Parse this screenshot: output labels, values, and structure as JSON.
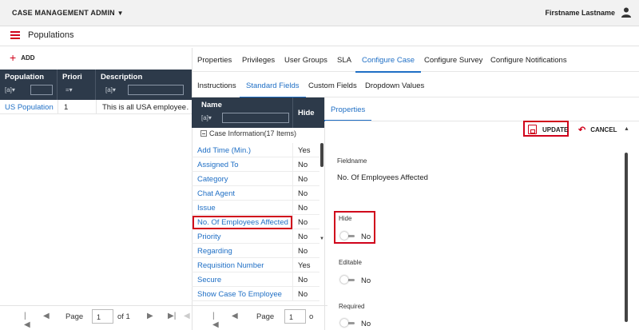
{
  "topbar": {
    "app_name": "CASE MANAGEMENT ADMIN",
    "dropdown_icon": "caret-down-icon",
    "user_name": "Firstname Lastname",
    "user_icon": "person-icon"
  },
  "page": {
    "title": "Populations",
    "add_label": "ADD"
  },
  "populations_grid": {
    "columns": [
      "Population",
      "Priori",
      "Description"
    ],
    "filter_symbols": {
      "text": "[a]▾",
      "equals": "=▾"
    },
    "rows": [
      {
        "population": "US Population",
        "priority": "1",
        "description": "This is all USA employee…"
      }
    ]
  },
  "main_tabs": [
    "Properties",
    "Privileges",
    "User Groups",
    "SLA",
    "Configure Case",
    "Configure Survey",
    "Configure Notifications"
  ],
  "active_main_tab": "Configure Case",
  "sub_tabs": [
    "Instructions",
    "Standard Fields",
    "Custom Fields",
    "Dropdown Values"
  ],
  "active_sub_tab": "Standard Fields",
  "fields_grid": {
    "columns": {
      "name": "Name",
      "hide": "Hide"
    },
    "group_label": "Case Information(17 Items)",
    "rows": [
      {
        "name": "Add Time (Min.)",
        "hide": "Yes"
      },
      {
        "name": "Assigned To",
        "hide": "No"
      },
      {
        "name": "Category",
        "hide": "No"
      },
      {
        "name": "Chat Agent",
        "hide": "No"
      },
      {
        "name": "Issue",
        "hide": "No"
      },
      {
        "name": "No. Of Employees Affected",
        "hide": "No"
      },
      {
        "name": "Priority",
        "hide": "No"
      },
      {
        "name": "Regarding",
        "hide": "No"
      },
      {
        "name": "Requisition Number",
        "hide": "Yes"
      },
      {
        "name": "Secure",
        "hide": "No"
      },
      {
        "name": "Show Case To Employee",
        "hide": "No"
      }
    ]
  },
  "properties_panel": {
    "tab_label": "Properties",
    "update_label": "UPDATE",
    "cancel_label": "CANCEL",
    "fieldname_label": "Fieldname",
    "fieldname_value": "No. Of Employees Affected",
    "hide_label": "Hide",
    "hide_value": "No",
    "editable_label": "Editable",
    "editable_value": "No",
    "required_label": "Required",
    "required_value": "No"
  },
  "pager_left": {
    "page_label": "Page",
    "page_value": "1",
    "of_label": "of 1"
  },
  "pager_mid": {
    "page_label": "Page",
    "page_value": "1",
    "of_label": "o"
  },
  "accent_colors": {
    "brand_red": "#d0021b",
    "link_blue": "#1f6fc5",
    "grid_header": "#2d3a4a"
  }
}
